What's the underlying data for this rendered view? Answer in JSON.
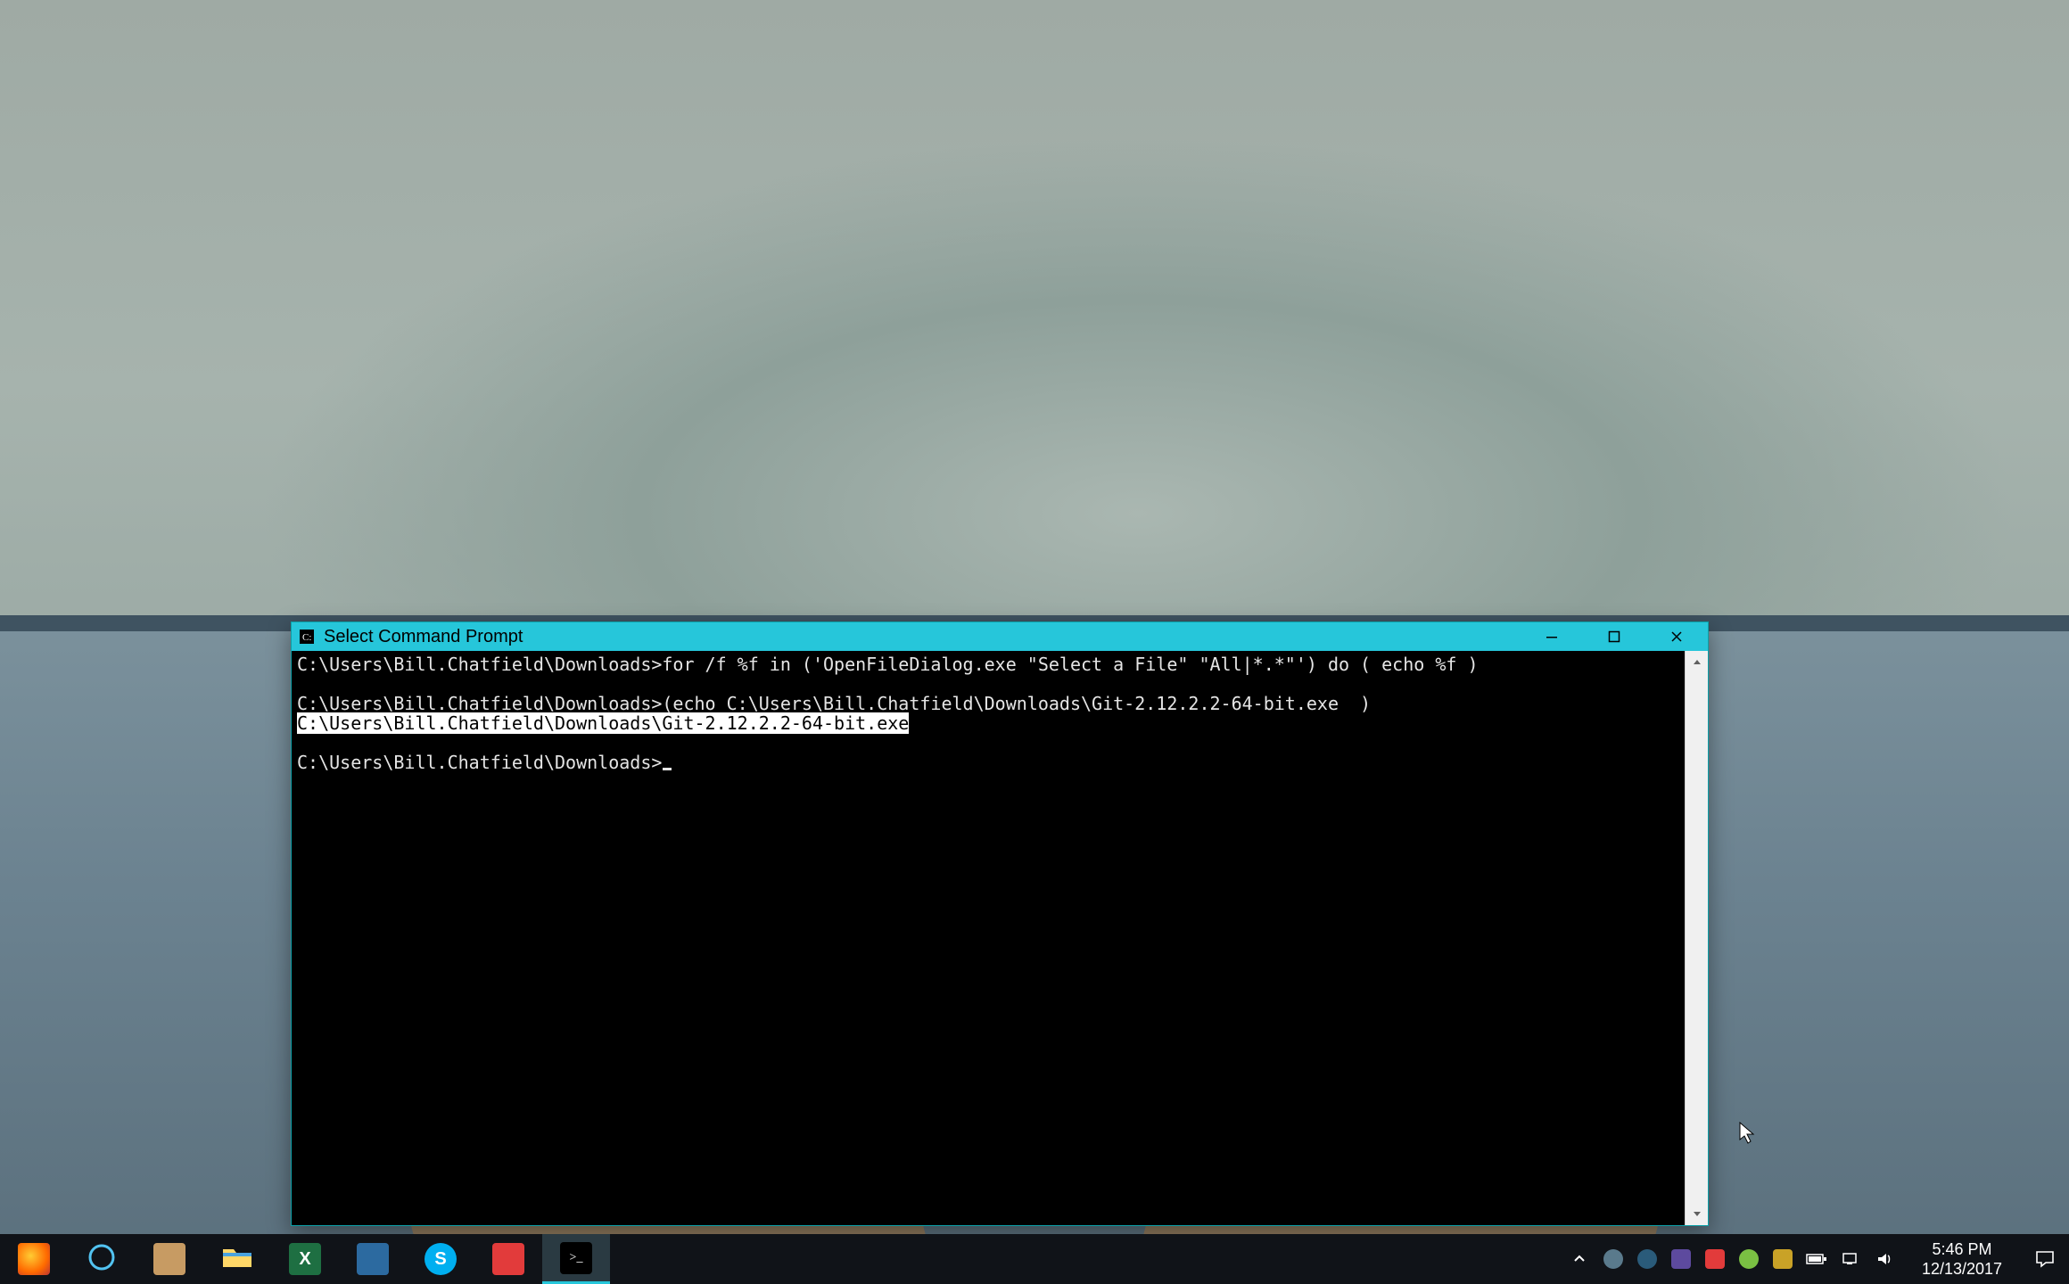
{
  "window": {
    "title": "Select Command Prompt"
  },
  "terminal": {
    "line1": "C:\\Users\\Bill.Chatfield\\Downloads>for /f %f in ('OpenFileDialog.exe \"Select a File\" \"All|*.*\"') do ( echo %f )",
    "blank1": "",
    "line2": "C:\\Users\\Bill.Chatfield\\Downloads>(echo C:\\Users\\Bill.Chatfield\\Downloads\\Git-2.12.2.2-64-bit.exe  )",
    "line3_selected": "C:\\Users\\Bill.Chatfield\\Downloads\\Git-2.12.2.2-64-bit.exe",
    "blank2": "",
    "prompt": "C:\\Users\\Bill.Chatfield\\Downloads>"
  },
  "taskbar": {
    "clock_time": "5:46 PM",
    "clock_date": "12/13/2017"
  }
}
